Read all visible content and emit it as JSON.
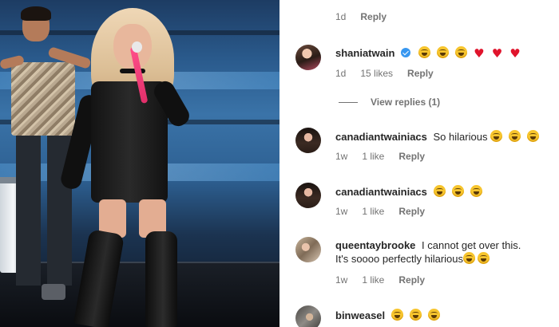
{
  "comments": [
    {
      "id": "top",
      "text": "",
      "time": "1d",
      "reply_label": "Reply"
    },
    {
      "id": "shania",
      "username": "shaniatwain",
      "verified": true,
      "emoji_icons": [
        "grinning-squinting-face",
        "grinning-squinting-face",
        "grinning-squinting-face",
        "red-heart",
        "red-heart",
        "red-heart"
      ],
      "time": "1d",
      "likes": "15 likes",
      "reply_label": "Reply",
      "view_replies": "View replies (1)"
    },
    {
      "id": "cw1",
      "username": "canadiantwainiacs",
      "text": "So hilarious",
      "emoji_icons": [
        "grinning-squinting-face",
        "grinning-squinting-face",
        "grinning-squinting-face"
      ],
      "time": "1w",
      "likes": "1 like",
      "reply_label": "Reply"
    },
    {
      "id": "cw2",
      "username": "canadiantwainiacs",
      "text": "",
      "emoji_icons": [
        "grinning-squinting-face",
        "grinning-squinting-face",
        "grinning-squinting-face"
      ],
      "time": "1w",
      "likes": "1 like",
      "reply_label": "Reply"
    },
    {
      "id": "qt",
      "username": "queentaybrooke",
      "text_line1": "I cannot get over this.",
      "text_line2": "It's soooo perfectly hilarious",
      "emoji_icons": [
        "grinning-squinting-face",
        "grinning-squinting-face"
      ],
      "time": "1w",
      "likes": "1 like",
      "reply_label": "Reply"
    },
    {
      "id": "bw",
      "username": "binweasel",
      "emoji_icons": [
        "grinning-squinting-face",
        "grinning-squinting-face",
        "grinning-squinting-face"
      ]
    }
  ]
}
